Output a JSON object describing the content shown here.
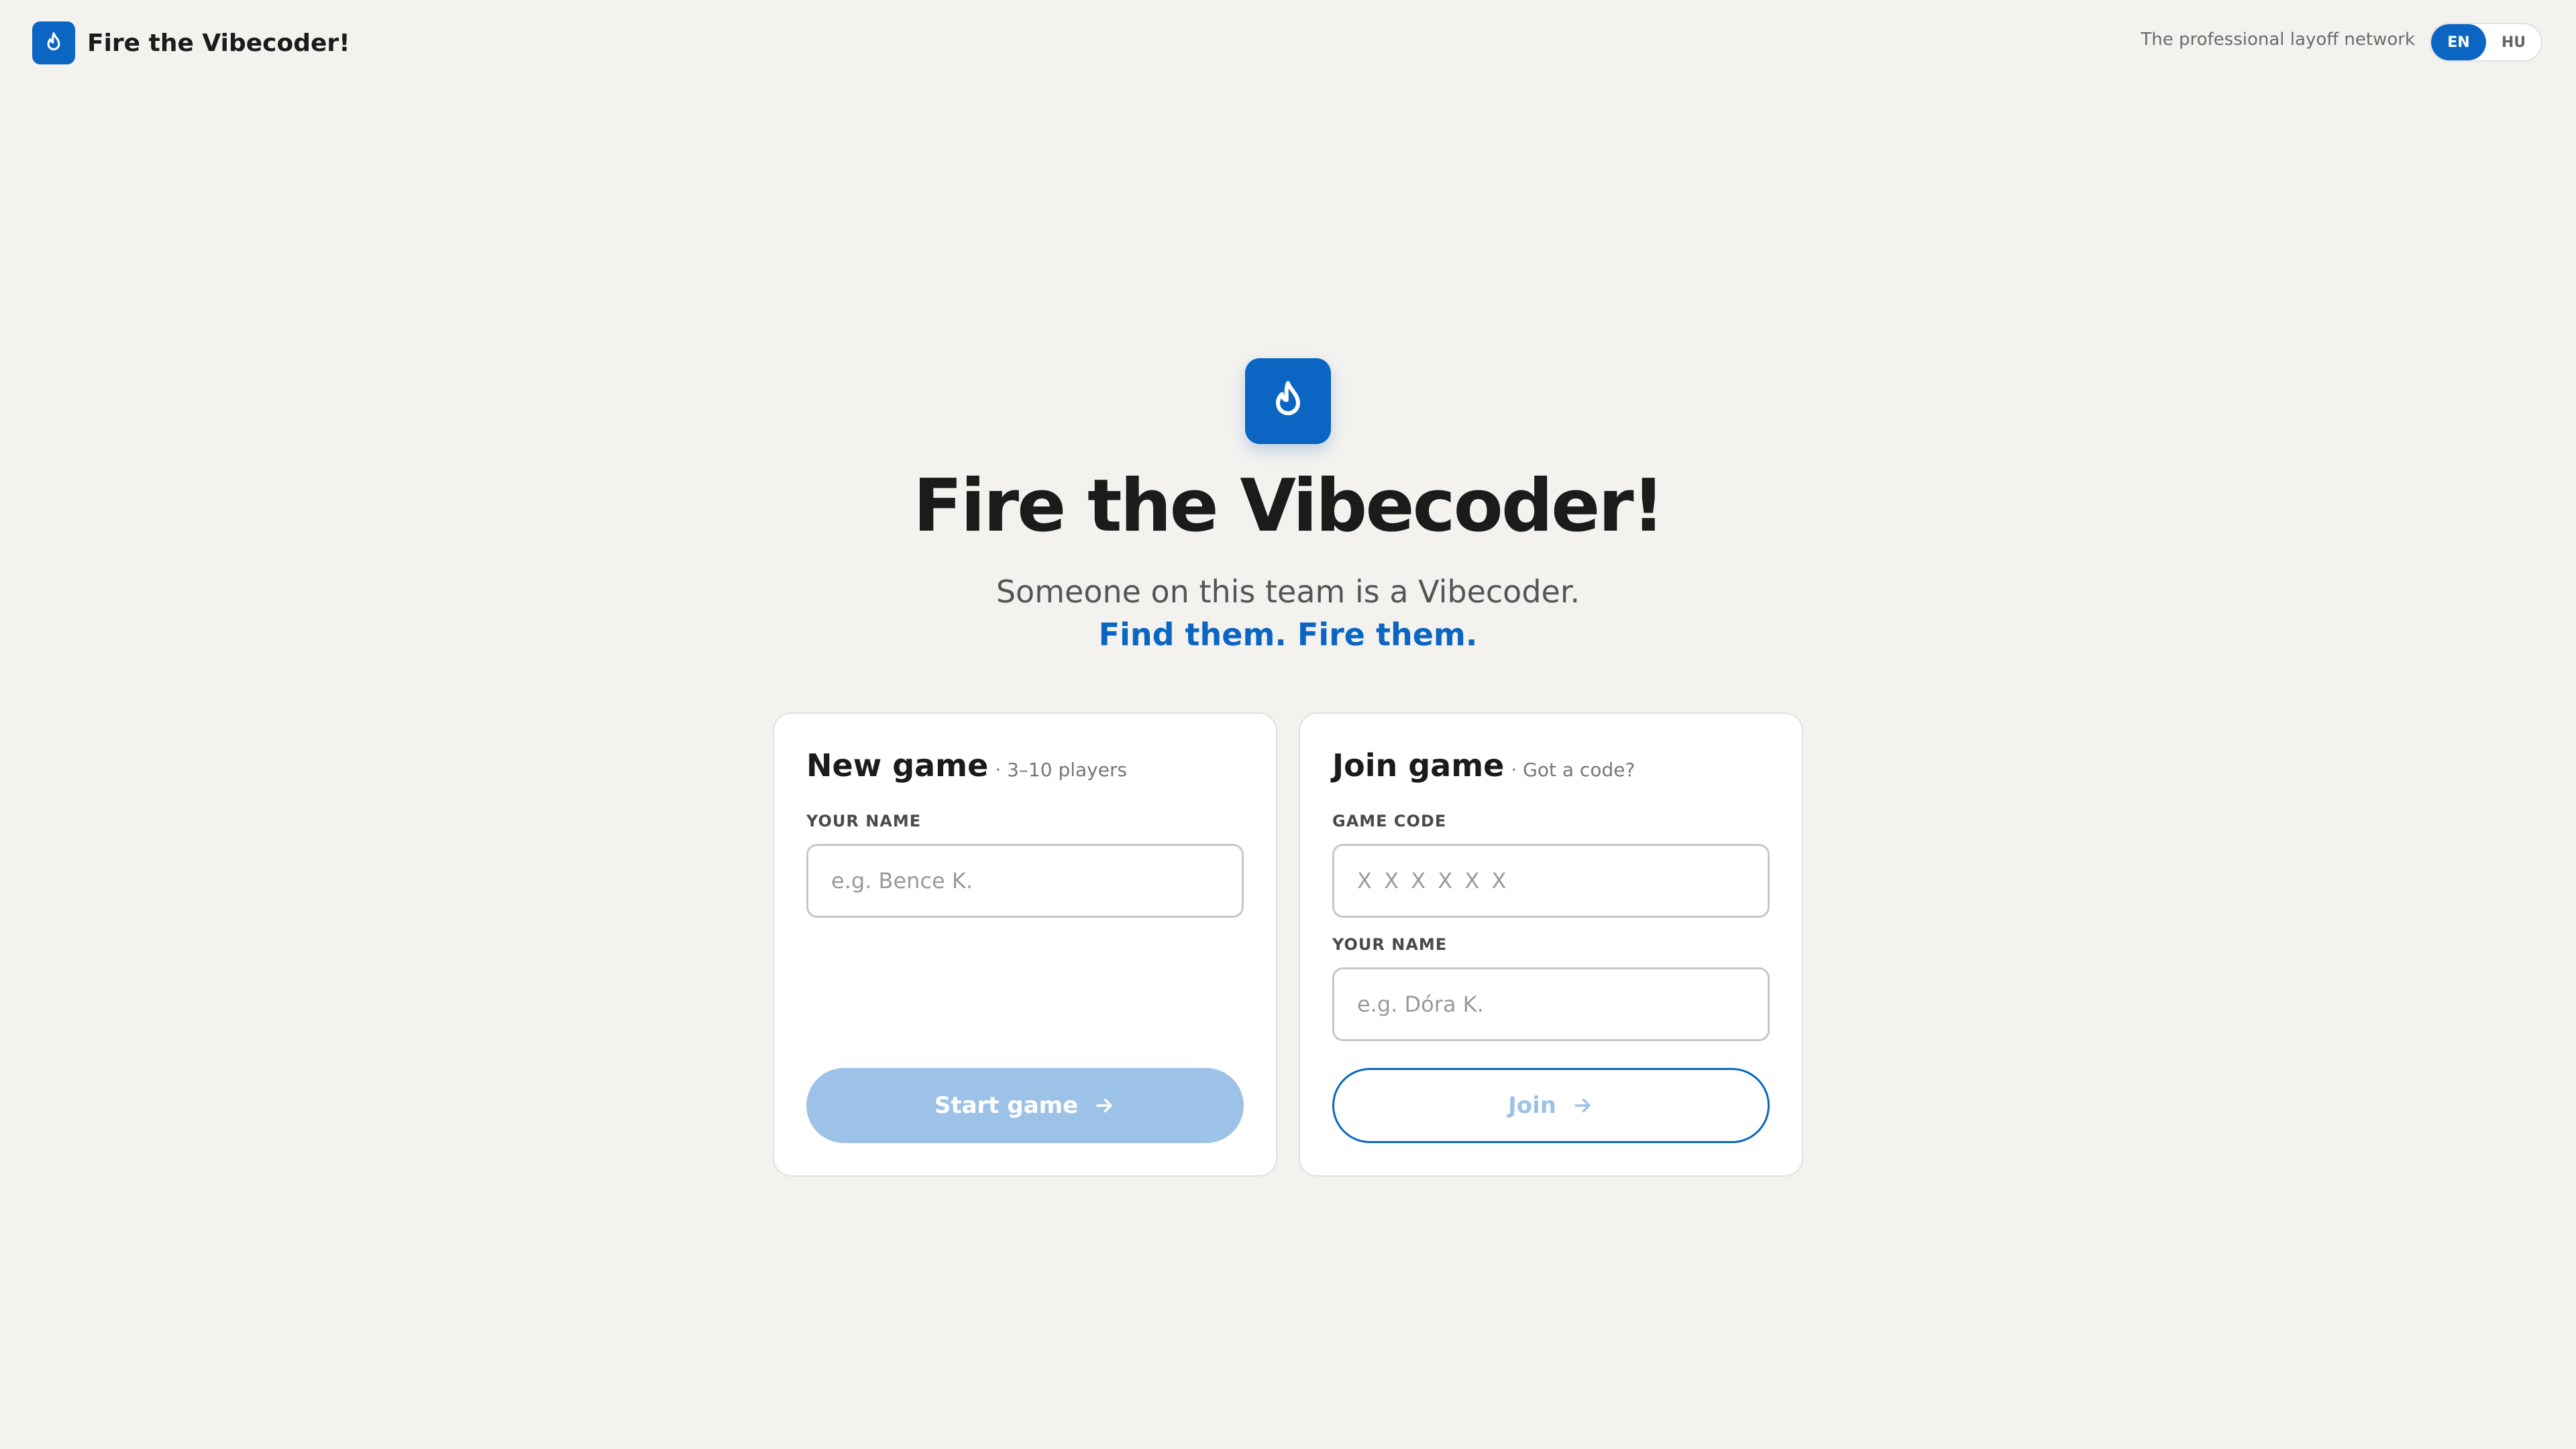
{
  "header": {
    "brand_name": "Fire the Vibecoder!",
    "tagline": "The professional layoff network",
    "languages": [
      {
        "code": "EN",
        "active": true
      },
      {
        "code": "HU",
        "active": false
      }
    ]
  },
  "hero": {
    "title": "Fire the Vibecoder!",
    "subtitle": "Someone on this team is a Vibecoder.",
    "cta": "Find them. Fire them."
  },
  "new_game": {
    "title": "New game",
    "note": "· 3–10 players",
    "name_label": "YOUR NAME",
    "name_placeholder": "e.g. Bence K.",
    "name_value": "",
    "button_label": "Start game"
  },
  "join_game": {
    "title": "Join game",
    "note": "· Got a code?",
    "code_label": "GAME CODE",
    "code_placeholder": "X X X X X X",
    "code_value": "",
    "name_label": "YOUR NAME",
    "name_placeholder": "e.g. Dóra K.",
    "name_value": "",
    "button_label": "Join"
  },
  "icons": {
    "brand": "flame-icon",
    "hero": "flame-icon",
    "button_arrow": "arrow-right-icon"
  },
  "colors": {
    "accent": "#0a66c2",
    "accent_disabled": "#9dc2e7",
    "background": "#f3f2ef",
    "card": "#ffffff",
    "text": "#1b1b1b",
    "muted": "#6b6b6b"
  }
}
